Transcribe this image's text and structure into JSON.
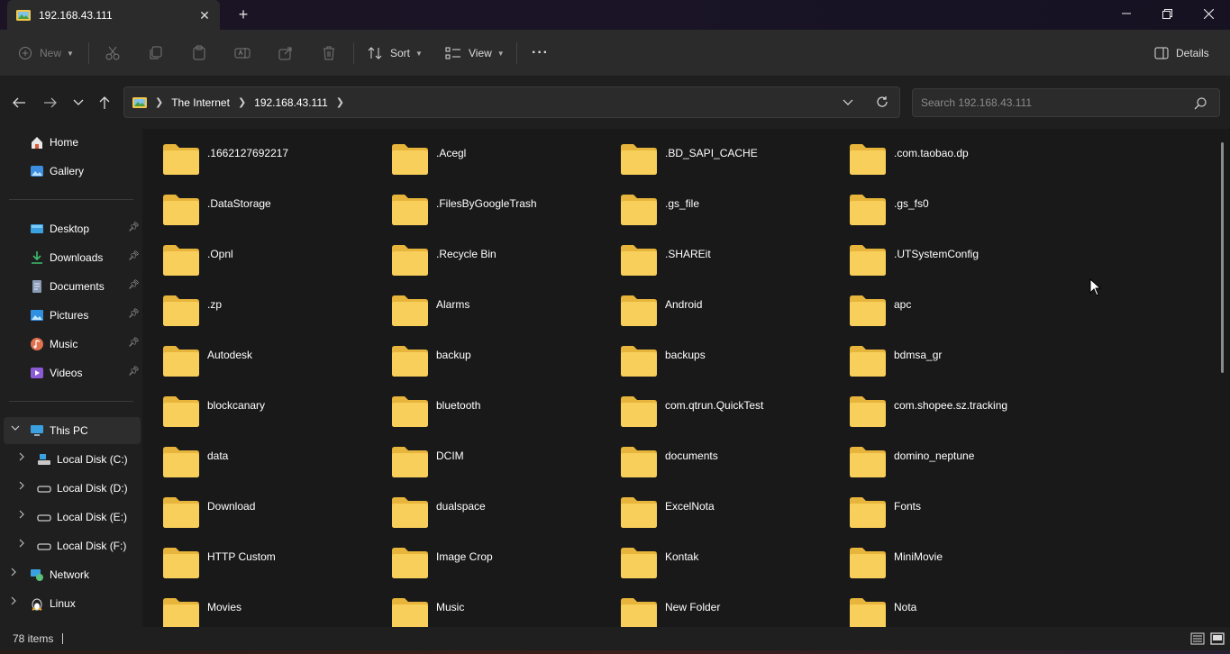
{
  "window": {
    "tab_title": "192.168.43.111",
    "new_tab_symbol": "+",
    "close_tab_symbol": "✕"
  },
  "toolbar": {
    "new_label": "New",
    "sort_label": "Sort",
    "view_label": "View",
    "more_label": "···",
    "details_label": "Details"
  },
  "address": {
    "crumbs": [
      "The Internet",
      "192.168.43.111"
    ],
    "search_placeholder": "Search 192.168.43.111"
  },
  "sidebar": {
    "quick": [
      {
        "label": "Home",
        "icon": "home-icon"
      },
      {
        "label": "Gallery",
        "icon": "gallery-icon"
      }
    ],
    "pinned": [
      {
        "label": "Desktop",
        "icon": "desktop-icon"
      },
      {
        "label": "Downloads",
        "icon": "downloads-icon"
      },
      {
        "label": "Documents",
        "icon": "documents-icon"
      },
      {
        "label": "Pictures",
        "icon": "pictures-icon"
      },
      {
        "label": "Music",
        "icon": "music-icon"
      },
      {
        "label": "Videos",
        "icon": "videos-icon"
      }
    ],
    "this_pc": "This PC",
    "drives": [
      "Local Disk (C:)",
      "Local Disk (D:)",
      "Local Disk (E:)",
      "Local Disk (F:)"
    ],
    "network": "Network",
    "linux": "Linux"
  },
  "folders": [
    ".1662127692217",
    ".Acegl",
    ".BD_SAPI_CACHE",
    ".com.taobao.dp",
    ".DataStorage",
    ".FilesByGoogleTrash",
    ".gs_file",
    ".gs_fs0",
    ".Opnl",
    ".Recycle Bin",
    ".SHAREit",
    ".UTSystemConfig",
    ".zp",
    "Alarms",
    "Android",
    "apc",
    "Autodesk",
    "backup",
    "backups",
    "bdmsa_gr",
    "blockcanary",
    "bluetooth",
    "com.qtrun.QuickTest",
    "com.shopee.sz.tracking",
    "data",
    "DCIM",
    "documents",
    "domino_neptune",
    "Download",
    "dualspace",
    "ExcelNota",
    "Fonts",
    "HTTP Custom",
    "Image Crop",
    "Kontak",
    "MiniMovie",
    "Movies",
    "Music",
    "New Folder",
    "Nota"
  ],
  "status": {
    "item_count": "78 items"
  },
  "colors": {
    "folder": "#f8cf5b",
    "folder_dark": "#e8b53c",
    "accent": "#4cc2ff"
  }
}
